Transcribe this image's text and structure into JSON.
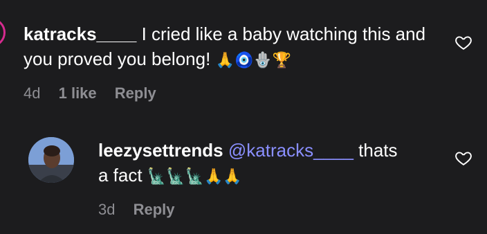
{
  "comment": {
    "username": "katracks____",
    "text": " I cried like a baby watching this and you proved you belong! ",
    "emojis": "🙏🧿🪬🏆",
    "age": "4d",
    "likes": "1 like",
    "reply_label": "Reply"
  },
  "reply": {
    "username": "leezysettrends",
    "mention": "@katracks____",
    "text_before": " thats",
    "text_after": "a fact ",
    "emojis": "🗽🗽🗽🙏🙏",
    "age": "3d",
    "reply_label": "Reply"
  },
  "icons": {
    "like": "heart-outline-icon",
    "avatar": "user-avatar"
  },
  "colors": {
    "background": "#1c1c1e",
    "text": "#ffffff",
    "meta": "#8e8e93",
    "mention": "#8a8fff",
    "story_ring": "#d62b8f"
  }
}
